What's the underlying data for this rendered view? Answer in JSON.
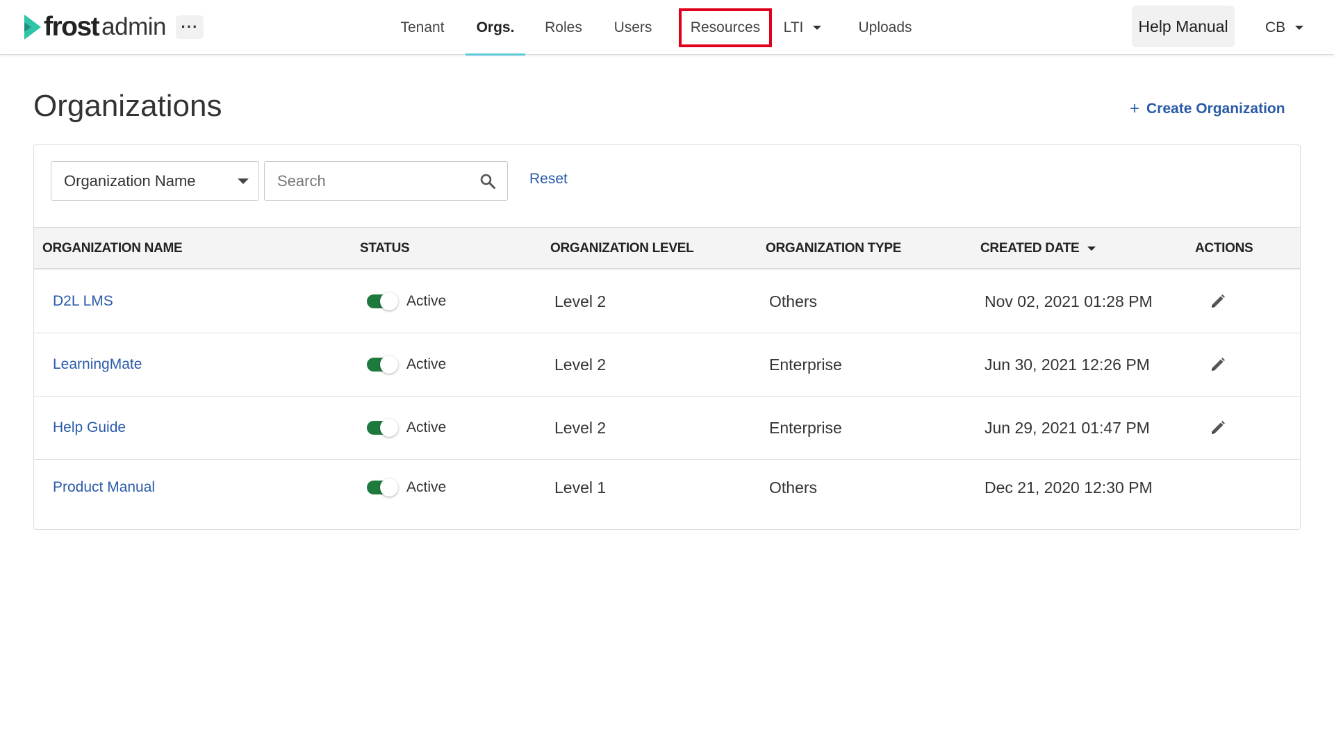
{
  "brand": {
    "name_bold": "frost",
    "name_light": "admin",
    "accent_color": "#2ec4a6"
  },
  "nav": {
    "more_label": "···",
    "items": [
      {
        "label": "Tenant",
        "active": false
      },
      {
        "label": "Orgs.",
        "active": true
      },
      {
        "label": "Roles",
        "active": false
      },
      {
        "label": "Users",
        "active": false
      },
      {
        "label": "Resources",
        "active": false,
        "highlighted": true
      },
      {
        "label": "LTI",
        "active": false,
        "has_dropdown": true
      },
      {
        "label": "Uploads",
        "active": false
      }
    ],
    "help_label": "Help Manual",
    "user_initials": "CB"
  },
  "page": {
    "title": "Organizations",
    "create_label": "Create Organization",
    "create_icon": "plus-icon"
  },
  "filters": {
    "field_selected": "Organization Name",
    "search_placeholder": "Search",
    "search_value": "",
    "reset_label": "Reset"
  },
  "table": {
    "columns": {
      "name": "ORGANIZATION NAME",
      "status": "STATUS",
      "level": "ORGANIZATION LEVEL",
      "type": "ORGANIZATION TYPE",
      "created": "CREATED DATE",
      "actions": "ACTIONS"
    },
    "sort": {
      "column": "created",
      "direction": "desc"
    },
    "rows": [
      {
        "name": "D2L LMS",
        "status": "Active",
        "active": true,
        "level": "Level 2",
        "type": "Others",
        "created": "Nov 02, 2021 01:28 PM",
        "editable": true
      },
      {
        "name": "LearningMate",
        "status": "Active",
        "active": true,
        "level": "Level 2",
        "type": "Enterprise",
        "created": "Jun 30, 2021 12:26 PM",
        "editable": true
      },
      {
        "name": "Help Guide",
        "status": "Active",
        "active": true,
        "level": "Level 2",
        "type": "Enterprise",
        "created": "Jun 29, 2021 01:47 PM",
        "editable": true
      },
      {
        "name": "Product Manual",
        "status": "Active",
        "active": true,
        "level": "Level 1",
        "type": "Others",
        "created": "Dec 21, 2020 12:30 PM",
        "editable": false
      }
    ]
  },
  "colors": {
    "link": "#2a5ba8",
    "toggle_on": "#1e7a3c",
    "active_tab_underline": "#5ccad9",
    "highlight_box": "#e0001b"
  }
}
